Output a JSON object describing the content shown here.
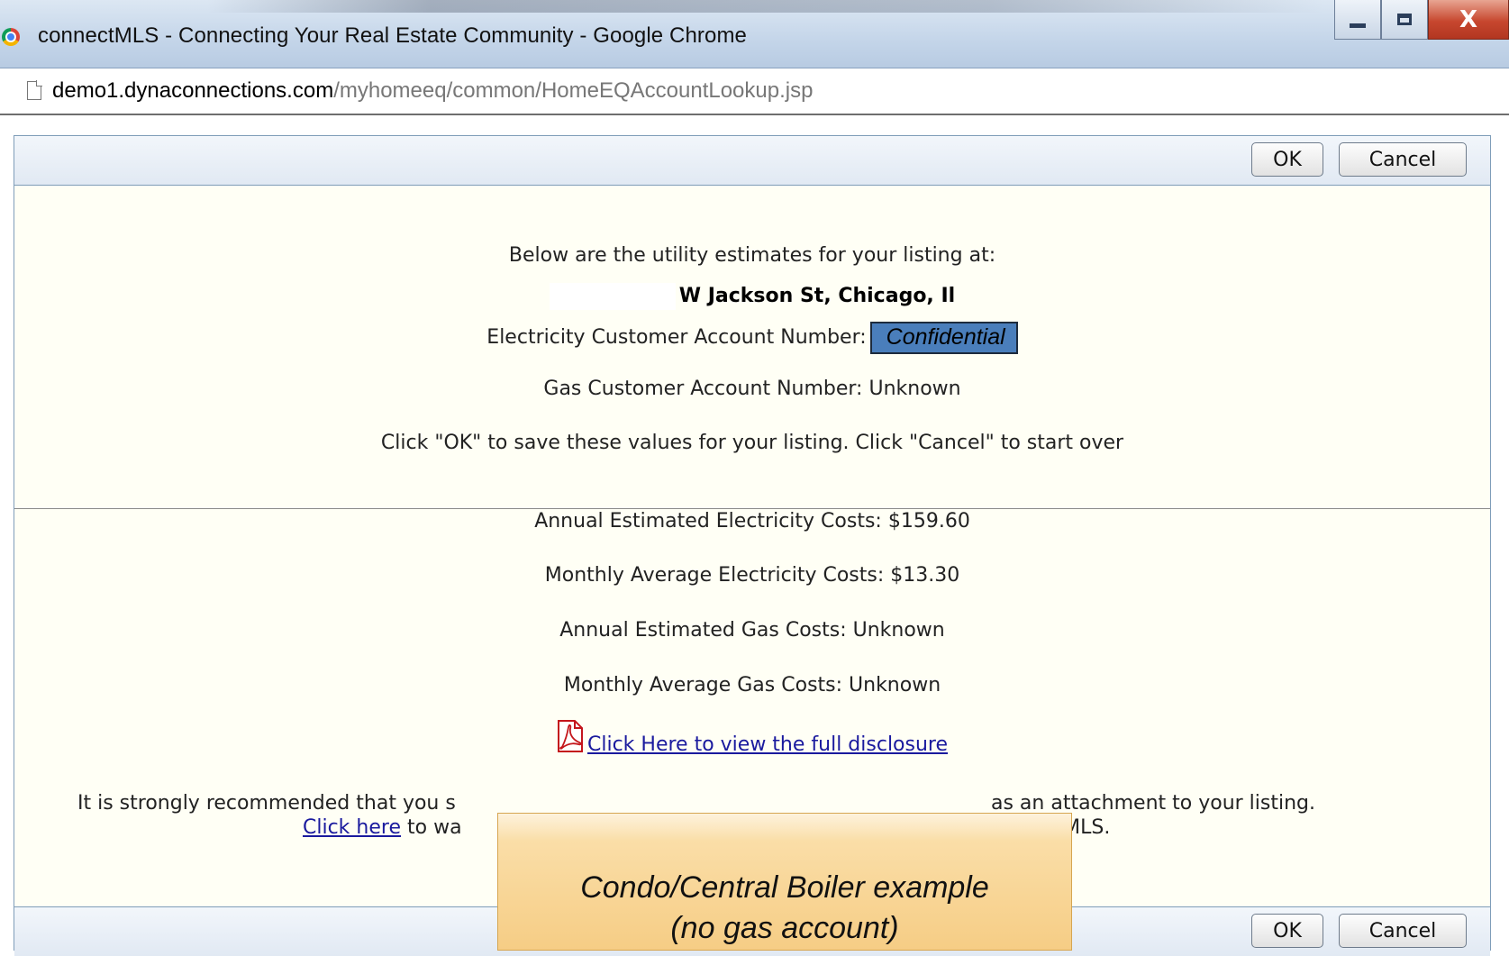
{
  "window": {
    "title": "connectMLS - Connecting Your Real Estate Community - Google Chrome",
    "url_host": "demo1.dynaconnections.com",
    "url_path": "/myhomeeq/common/HomeEQAccountLookup.jsp",
    "close_label": "X"
  },
  "dialog": {
    "ok_label": "OK",
    "cancel_label": "Cancel",
    "intro": "Below are the utility estimates for your listing at:",
    "address": "W Jackson St, Chicago, Il",
    "electric_account_label": "Electricity Customer Account Number:",
    "electric_account_value": "Confidential",
    "gas_account_line": "Gas Customer Account Number: Unknown",
    "instruction": "Click \"OK\" to save these values for your listing. Click \"Cancel\" to start over",
    "annual_electric": "Annual Estimated Electricity Costs: $159.60",
    "monthly_electric": "Monthly Average Electricity Costs: $13.30",
    "annual_gas": "Annual Estimated Gas Costs: Unknown",
    "monthly_gas": "Monthly Average Gas Costs: Unknown",
    "disclosure_link": "Click Here to view the full disclosure",
    "recommend_left": "It is strongly recommended that you s",
    "recommend_right": "as an attachment to your listing.",
    "click_here_link": "Click here",
    "walk_left": " to wa",
    "walk_right": "nnectMLS."
  },
  "callout": {
    "line1": "Condo/Central Boiler example",
    "line2": "(no gas account)"
  }
}
